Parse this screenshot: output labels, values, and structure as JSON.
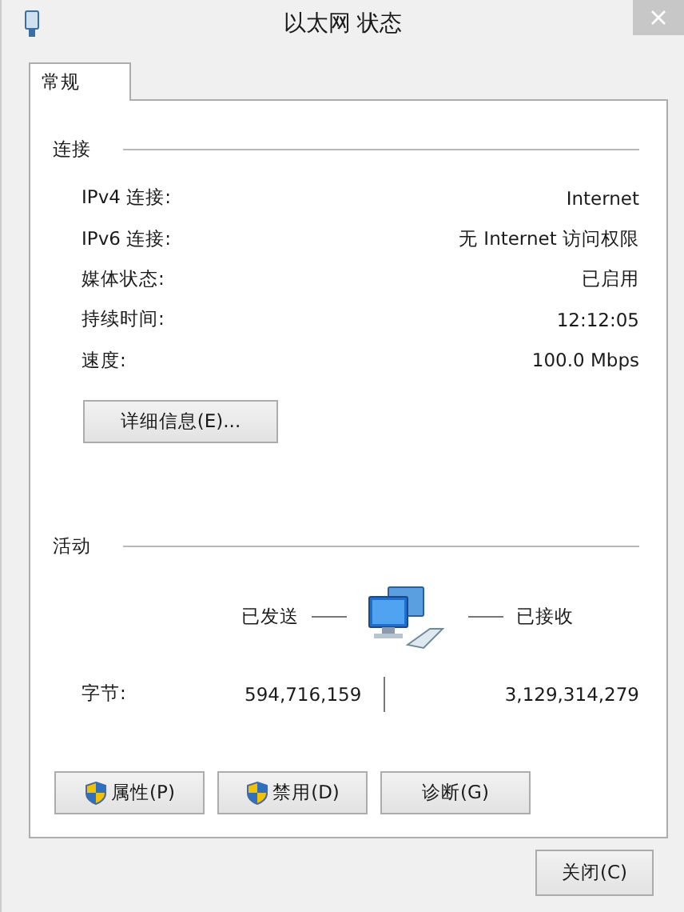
{
  "window": {
    "title": "以太网 状态"
  },
  "tabs": [
    {
      "label": "常规",
      "selected": true
    }
  ],
  "connection": {
    "heading": "连接",
    "rows": [
      {
        "label": "IPv4 连接:",
        "value": "Internet"
      },
      {
        "label": "IPv6 连接:",
        "value": "无 Internet 访问权限"
      },
      {
        "label": "媒体状态:",
        "value": "已启用"
      },
      {
        "label": "持续时间:",
        "value": "12:12:05"
      },
      {
        "label": "速度:",
        "value": "100.0 Mbps"
      }
    ],
    "details_button": "详细信息(E)..."
  },
  "activity": {
    "heading": "活动",
    "sent_label": "已发送",
    "received_label": "已接收",
    "bytes_label": "字节:",
    "bytes_sent": "594,716,159",
    "bytes_received": "3,129,314,279"
  },
  "buttons": [
    {
      "label": "属性(P)",
      "kind": "shield"
    },
    {
      "label": "禁用(D)",
      "kind": "shield"
    },
    {
      "label": "诊断(G)",
      "kind": "plain"
    }
  ],
  "close_button": "关闭(C)"
}
